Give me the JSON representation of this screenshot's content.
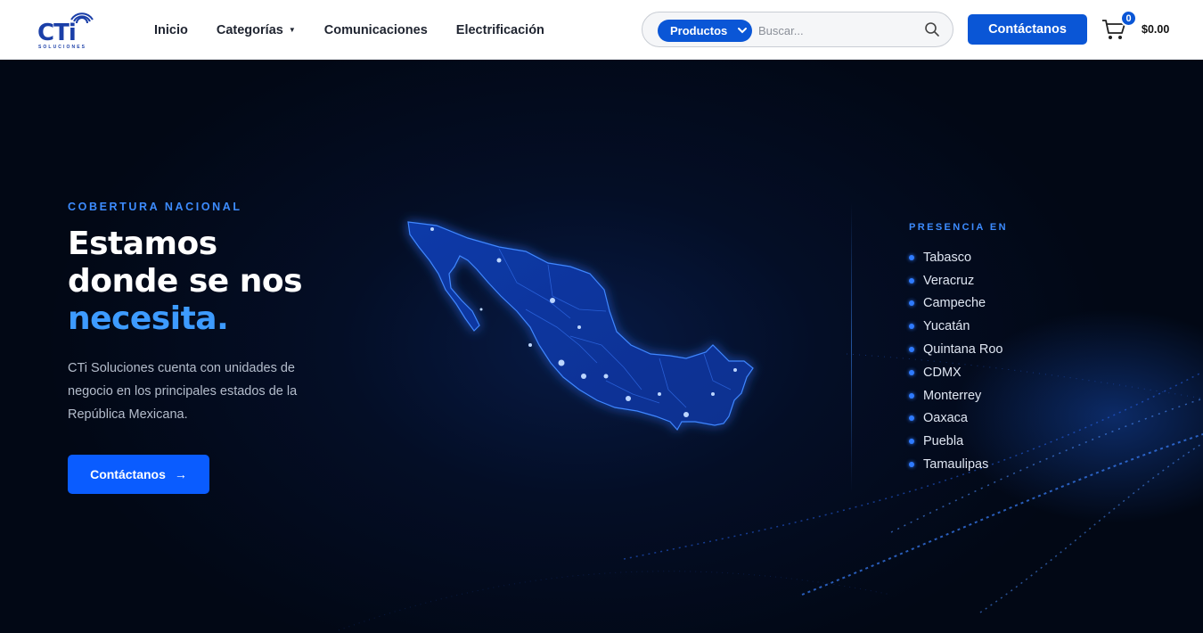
{
  "brand": {
    "logo_text": "CTi",
    "logo_subtext": "SOLUCIONES"
  },
  "nav": {
    "items": [
      {
        "label": "Inicio"
      },
      {
        "label": "Categorías",
        "has_dropdown": true
      },
      {
        "label": "Comunicaciones"
      },
      {
        "label": "Electrificación"
      }
    ]
  },
  "search": {
    "category_selected": "Productos",
    "placeholder": "Buscar..."
  },
  "header": {
    "contact_label": "Contáctanos"
  },
  "cart": {
    "count": "0",
    "total": "$0.00"
  },
  "hero": {
    "eyebrow": "COBERTURA NACIONAL",
    "headline_line1": "Estamos",
    "headline_line2": "donde se nos",
    "headline_accent": "necesita.",
    "description": "CTi Soluciones cuenta con unidades de negocio en los principales estados de la República Mexicana.",
    "cta_label": "Contáctanos",
    "presence_title": "PRESENCIA EN",
    "presence": [
      "Tabasco",
      "Veracruz",
      "Campeche",
      "Yucatán",
      "Quintana Roo",
      "CDMX",
      "Monterrey",
      "Oaxaca",
      "Puebla",
      "Tamaulipas"
    ]
  },
  "colors": {
    "primary": "#0a56d6",
    "accent": "#3d9bff",
    "hero_bg": "#030a1a"
  }
}
